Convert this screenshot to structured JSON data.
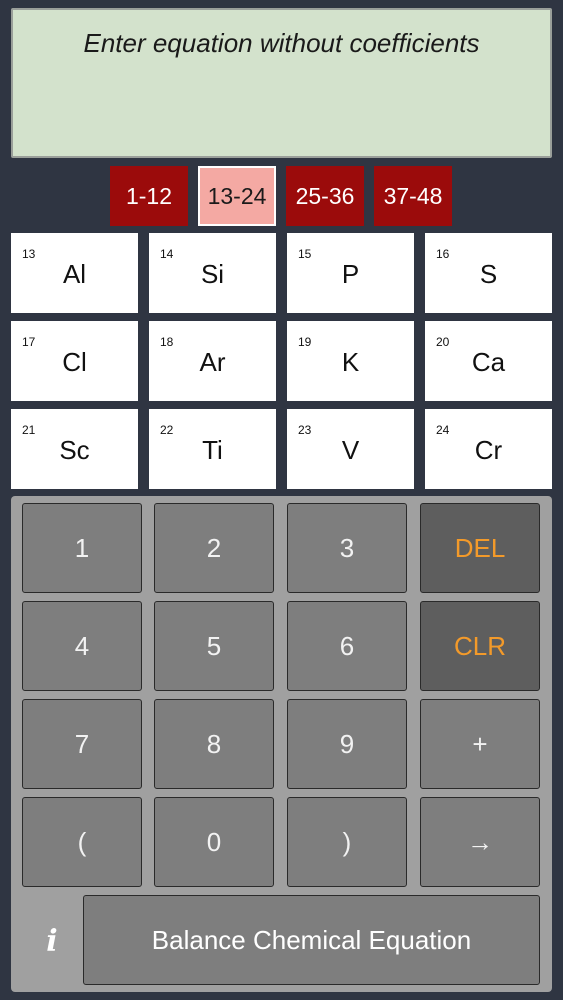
{
  "display": {
    "prompt": "Enter equation without coefficients"
  },
  "range_tabs": [
    "1-12",
    "13-24",
    "25-36",
    "37-48"
  ],
  "active_range": "13-24",
  "elements": [
    {
      "num": "13",
      "sym": "Al"
    },
    {
      "num": "14",
      "sym": "Si"
    },
    {
      "num": "15",
      "sym": "P"
    },
    {
      "num": "16",
      "sym": "S"
    },
    {
      "num": "17",
      "sym": "Cl"
    },
    {
      "num": "18",
      "sym": "Ar"
    },
    {
      "num": "19",
      "sym": "K"
    },
    {
      "num": "20",
      "sym": "Ca"
    },
    {
      "num": "21",
      "sym": "Sc"
    },
    {
      "num": "22",
      "sym": "Ti"
    },
    {
      "num": "23",
      "sym": "V"
    },
    {
      "num": "24",
      "sym": "Cr"
    }
  ],
  "keypad": {
    "digits": [
      "1",
      "2",
      "3",
      "4",
      "5",
      "6",
      "7",
      "8",
      "9",
      "0"
    ],
    "open_paren": "(",
    "close_paren": ")",
    "plus": "+",
    "arrow": "→",
    "del": "DEL",
    "clr": "CLR",
    "info": "i",
    "balance": "Balance Chemical Equation"
  },
  "colors": {
    "background": "#2f3542",
    "display_bg": "#d3e2cc",
    "tab_red": "#9b0b0b",
    "tab_active": "#f4a9a3",
    "key_gray": "#7e7e7e",
    "key_dark": "#5e5e5e",
    "accent_orange": "#f39a2a"
  }
}
